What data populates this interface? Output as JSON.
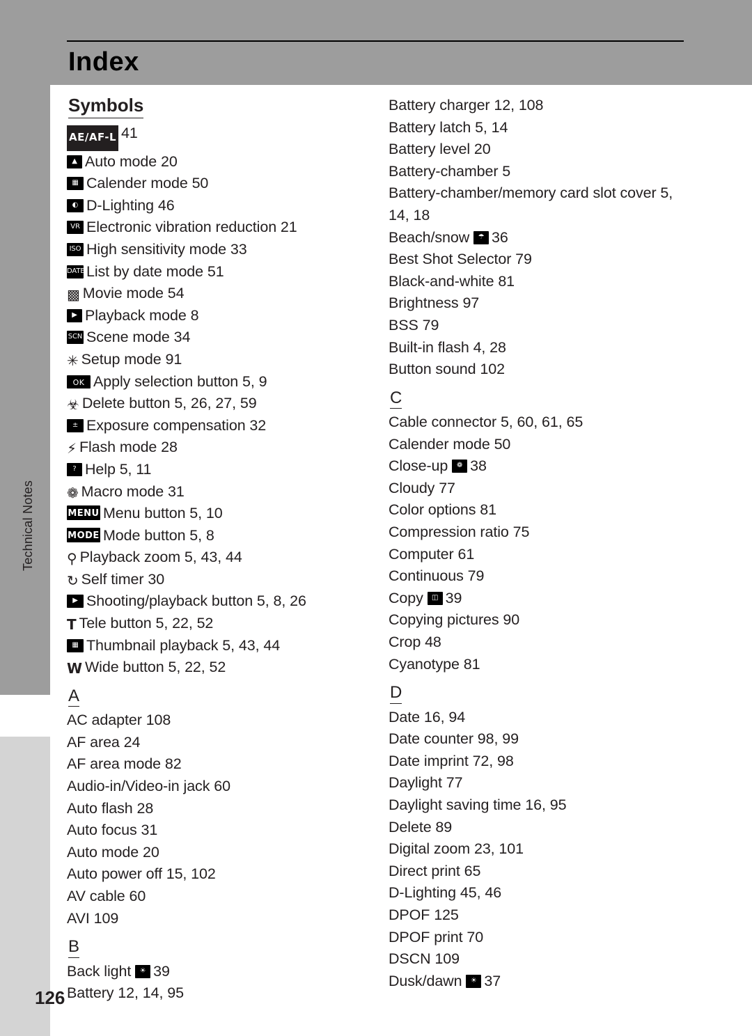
{
  "page": {
    "title": "Index",
    "number": "126",
    "side_tab_label": "Technical Notes"
  },
  "columns": {
    "left": {
      "sections": [
        {
          "heading": "Symbols",
          "entries": [
            {
              "icon": "ae-af-lock-icon",
              "icon_glyph": "AE/AF-L",
              "text": "41"
            },
            {
              "icon": "auto-mode-icon",
              "icon_glyph": "▲",
              "text": "Auto mode 20"
            },
            {
              "icon": "calender-mode-icon",
              "icon_glyph": "Ὄ5",
              "text": "Calender mode 50"
            },
            {
              "icon": "d-lighting-icon",
              "icon_glyph": "☀",
              "text": "D-Lighting 46"
            },
            {
              "icon": "electronic-vibration-reduction-icon",
              "icon_glyph": "VR",
              "text": "Electronic vibration reduction 21"
            },
            {
              "icon": "high-sensitivity-mode-icon",
              "icon_glyph": "ISO",
              "text": "High sensitivity mode 33"
            },
            {
              "icon": "list-by-date-mode-icon",
              "icon_glyph": "DATE",
              "text": "List by date mode 51"
            },
            {
              "icon": "movie-mode-icon",
              "icon_glyph": "Ἲ5",
              "text": "Movie mode 54"
            },
            {
              "icon": "playback-mode-icon",
              "icon_glyph": "▶",
              "text": "Playback mode 8"
            },
            {
              "icon": "scene-mode-icon",
              "icon_glyph": "SCENE",
              "text": "Scene mode 34"
            },
            {
              "icon": "setup-mode-icon",
              "icon_glyph": "ὒ7",
              "text": "Setup mode 91"
            },
            {
              "icon": "apply-selection-button-icon",
              "icon_glyph": "OK",
              "text": "Apply selection button 5, 9"
            },
            {
              "icon": "delete-button-icon",
              "icon_glyph": "Ὕ1",
              "text": "Delete button 5, 26, 27, 59"
            },
            {
              "icon": "exposure-compensation-icon",
              "icon_glyph": "±",
              "text": "Exposure compensation 32"
            },
            {
              "icon": "flash-mode-icon",
              "icon_glyph": "⚡",
              "text": "Flash mode 28"
            },
            {
              "icon": "help-icon",
              "icon_glyph": "?",
              "text": "Help 5, 11"
            },
            {
              "icon": "macro-mode-icon",
              "icon_glyph": "❁",
              "text": "Macro mode 31"
            },
            {
              "icon": "menu-button-icon",
              "icon_glyph": "MENU",
              "text": "Menu button 5, 10"
            },
            {
              "icon": "mode-button-icon",
              "icon_glyph": "MODE",
              "text": "Mode button 5, 8"
            },
            {
              "icon": "playback-zoom-icon",
              "icon_glyph": "ὐD",
              "text": "Playback zoom 5, 43, 44"
            },
            {
              "icon": "self-timer-icon",
              "icon_glyph": "⏱",
              "text": "Self timer 30"
            },
            {
              "icon": "shooting-playback-button-icon",
              "icon_glyph": "▶",
              "text": "Shooting/playback button 5, 8, 26"
            },
            {
              "icon": "tele-button-icon",
              "icon_glyph": "T",
              "text": "Tele button 5, 22, 52"
            },
            {
              "icon": "thumbnail-playback-icon",
              "icon_glyph": "▦",
              "text": "Thumbnail playback 5, 43, 44"
            },
            {
              "icon": "wide-button-icon",
              "icon_glyph": "W",
              "text": "Wide button 5, 22, 52"
            }
          ]
        },
        {
          "heading": "A",
          "entries": [
            {
              "icon": "",
              "icon_glyph": "",
              "text": "AC adapter 108"
            },
            {
              "icon": "",
              "icon_glyph": "",
              "text": "AF area 24"
            },
            {
              "icon": "",
              "icon_glyph": "",
              "text": "AF area mode 82"
            },
            {
              "icon": "",
              "icon_glyph": "",
              "text": "Audio-in/Video-in jack 60"
            },
            {
              "icon": "",
              "icon_glyph": "",
              "text": "Auto flash 28"
            },
            {
              "icon": "",
              "icon_glyph": "",
              "text": "Auto focus 31"
            },
            {
              "icon": "",
              "icon_glyph": "",
              "text": "Auto mode 20"
            },
            {
              "icon": "",
              "icon_glyph": "",
              "text": "Auto power off 15, 102"
            },
            {
              "icon": "",
              "icon_glyph": "",
              "text": "AV cable 60"
            },
            {
              "icon": "",
              "icon_glyph": "",
              "text": "AVI 109"
            }
          ]
        },
        {
          "heading": "B",
          "entries": [
            {
              "icon": "back-light-icon",
              "icon_glyph": "☀",
              "text_before": "Back light",
              "text": "39"
            },
            {
              "icon": "",
              "icon_glyph": "",
              "text": "Battery 12, 14, 95"
            }
          ]
        }
      ]
    },
    "right": {
      "sections": [
        {
          "heading": "",
          "entries": [
            {
              "icon": "",
              "icon_glyph": "",
              "text": "Battery charger 12, 108"
            },
            {
              "icon": "",
              "icon_glyph": "",
              "text": "Battery latch 5, 14"
            },
            {
              "icon": "",
              "icon_glyph": "",
              "text": "Battery level 20"
            },
            {
              "icon": "",
              "icon_glyph": "",
              "text": "Battery-chamber 5"
            },
            {
              "icon": "",
              "icon_glyph": "",
              "text": "Battery-chamber/memory card slot cover 5, 14, 18"
            },
            {
              "icon": "beach-snow-icon",
              "icon_glyph": "⛱",
              "text_before": "Beach/snow",
              "text": "36"
            },
            {
              "icon": "",
              "icon_glyph": "",
              "text": "Best Shot Selector 79"
            },
            {
              "icon": "",
              "icon_glyph": "",
              "text": "Black-and-white 81"
            },
            {
              "icon": "",
              "icon_glyph": "",
              "text": "Brightness 97"
            },
            {
              "icon": "",
              "icon_glyph": "",
              "text": "BSS 79"
            },
            {
              "icon": "",
              "icon_glyph": "",
              "text": "Built-in flash 4, 28"
            },
            {
              "icon": "",
              "icon_glyph": "",
              "text": "Button sound 102"
            }
          ]
        },
        {
          "heading": "C",
          "entries": [
            {
              "icon": "",
              "icon_glyph": "",
              "text": "Cable connector 5, 60, 61, 65"
            },
            {
              "icon": "",
              "icon_glyph": "",
              "text": "Calender mode 50"
            },
            {
              "icon": "close-up-icon",
              "icon_glyph": "❁",
              "text_before": "Close-up",
              "text": "38"
            },
            {
              "icon": "",
              "icon_glyph": "",
              "text": "Cloudy 77"
            },
            {
              "icon": "",
              "icon_glyph": "",
              "text": "Color options 81"
            },
            {
              "icon": "",
              "icon_glyph": "",
              "text": "Compression ratio 75"
            },
            {
              "icon": "",
              "icon_glyph": "",
              "text": "Computer 61"
            },
            {
              "icon": "",
              "icon_glyph": "",
              "text": "Continuous 79"
            },
            {
              "icon": "copy-icon",
              "icon_glyph": "⧉",
              "text_before": "Copy",
              "text": "39"
            },
            {
              "icon": "",
              "icon_glyph": "",
              "text": "Copying pictures 90"
            },
            {
              "icon": "",
              "icon_glyph": "",
              "text": "Crop 48"
            },
            {
              "icon": "",
              "icon_glyph": "",
              "text": "Cyanotype 81"
            }
          ]
        },
        {
          "heading": "D",
          "entries": [
            {
              "icon": "",
              "icon_glyph": "",
              "text": "Date 16, 94"
            },
            {
              "icon": "",
              "icon_glyph": "",
              "text": "Date counter 98, 99"
            },
            {
              "icon": "",
              "icon_glyph": "",
              "text": "Date imprint 72, 98"
            },
            {
              "icon": "",
              "icon_glyph": "",
              "text": "Daylight 77"
            },
            {
              "icon": "",
              "icon_glyph": "",
              "text": "Daylight saving time 16, 95"
            },
            {
              "icon": "",
              "icon_glyph": "",
              "text": "Delete 89"
            },
            {
              "icon": "",
              "icon_glyph": "",
              "text": "Digital zoom 23, 101"
            },
            {
              "icon": "",
              "icon_glyph": "",
              "text": "Direct print 65"
            },
            {
              "icon": "",
              "icon_glyph": "",
              "text": "D-Lighting 45, 46"
            },
            {
              "icon": "",
              "icon_glyph": "",
              "text": "DPOF 125"
            },
            {
              "icon": "",
              "icon_glyph": "",
              "text": "DPOF print 70"
            },
            {
              "icon": "",
              "icon_glyph": "",
              "text": "DSCN 109"
            },
            {
              "icon": "dusk-dawn-icon",
              "icon_glyph": "ἰ6",
              "text_before": "Dusk/dawn",
              "text": "37"
            }
          ]
        }
      ]
    }
  }
}
